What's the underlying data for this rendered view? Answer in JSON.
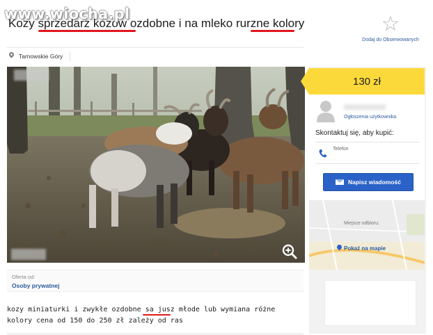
{
  "watermark": "www.wiocha.pl",
  "listing": {
    "title": "Kozy sprzedarz kozow ozdobne i na mleko rurzne kolory",
    "title_parts": [
      "Kozy ",
      "sprzedarz",
      " ko",
      "zow",
      " ozdobne i na mleko ",
      "rurzne",
      " kolory"
    ],
    "location": "Tarnowskie Góry",
    "offer_from_label": "Oferta od:",
    "offer_from_value": "Osoby prywatnej",
    "description_line1": "kozy miniaturki i zwykłe ozdobne sa jusz młode lub wymiana różne",
    "description_line2": "kolory cena od 150 do 250 zł zależy od ras",
    "desc_parts": [
      "kozy miniaturki i zwykłe ozdobne s",
      "a jusz",
      " młode lub wymiana różne"
    ]
  },
  "favorite": {
    "label": "Dodaj do Obserwowanych",
    "icon": "star-outline-icon"
  },
  "sidebar": {
    "price": "130 zł",
    "seller_link": "Ogłoszenia użytkownika",
    "contact_heading": "Skontaktuj się, aby kupić:",
    "phone_label": "Telefon",
    "message_button": "Napisz wiadomość",
    "pickup_label": "Miejsce odbioru:",
    "map_link": "Pokaż na mapie"
  },
  "colors": {
    "price_bg": "#fcd93a",
    "button_bg": "#2b62c8",
    "link": "#2a5a9c",
    "underline_red": "#e0161b"
  },
  "icons": [
    "location-pin-icon",
    "zoom-in-icon",
    "user-avatar-icon",
    "phone-icon",
    "envelope-icon",
    "map-pin-icon"
  ]
}
